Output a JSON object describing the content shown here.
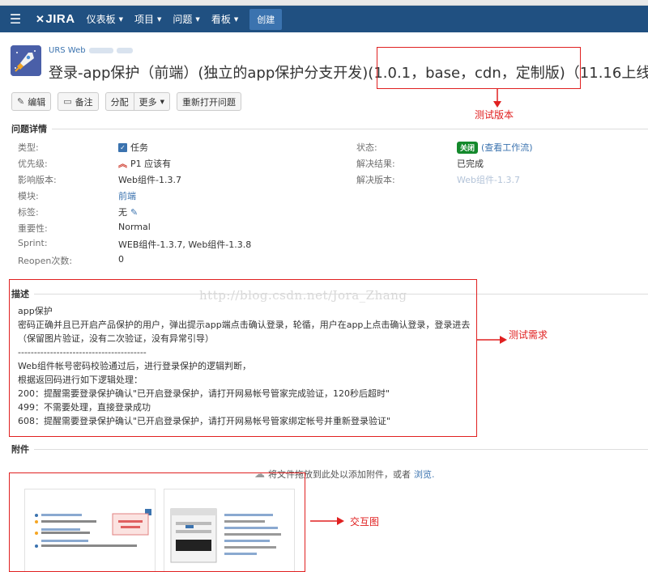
{
  "nav": {
    "logo": "JIRA",
    "items": [
      "仪表板",
      "项目",
      "问题",
      "看板"
    ],
    "create": "创建"
  },
  "header": {
    "project_key": "URS Web",
    "title": "登录-app保护（前端）(独立的app保护分支开发)(1.0.1，base，cdn，定制版)（11.16上线"
  },
  "toolbar": {
    "edit": "编辑",
    "comment": "备注",
    "assign": "分配",
    "more": "更多",
    "reopen": "重新打开问题"
  },
  "details": {
    "heading": "问题详情",
    "left": [
      {
        "label": "类型:",
        "value": "任务"
      },
      {
        "label": "优先级:",
        "value": "P1 应该有"
      },
      {
        "label": "影响版本:",
        "value": "Web组件-1.3.7"
      },
      {
        "label": "模块:",
        "value": "前端"
      },
      {
        "label": "标签:",
        "value": "无"
      },
      {
        "label": "重要性:",
        "value": "Normal"
      },
      {
        "label": "Sprint:",
        "value": "WEB组件-1.3.7, Web组件-1.3.8"
      },
      {
        "label": "Reopen次数:",
        "value": "0"
      }
    ],
    "right": [
      {
        "label": "状态:",
        "badge": "关闭",
        "value": "(查看工作流)"
      },
      {
        "label": "解决结果:",
        "value": "已完成"
      },
      {
        "label": "解决版本:",
        "value": "Web组件-1.3.7"
      }
    ]
  },
  "description": {
    "heading": "描述",
    "lines": [
      "app保护",
      "密码正确并且已开启产品保护的用户，弹出提示app端点击确认登录，轮循，用户在app上点击确认登录，登录进去",
      "（保留图片验证，没有二次验证，没有异常引导）",
      "----------------------------------------",
      "Web组件帐号密码校验通过后，进行登录保护的逻辑判断，",
      "根据返回码进行如下逻辑处理：",
      "200：提醒需要登录保护确认\"已开启登录保护，请打开网易帐号管家完成验证，120秒后超时\"",
      "499：不需要处理，直接登录成功",
      "608：提醒需要登录保护确认\"已开启登录保护，请打开网易帐号管家绑定帐号并重新登录验证\""
    ]
  },
  "attachments": {
    "heading": "附件",
    "drop_text": "将文件拖放到此处以添加附件，或者",
    "browse": "浏览."
  },
  "watermark": "http://blog.csdn.net/Jora_Zhang",
  "annotations": {
    "version": "测试版本",
    "requirements": "测试需求",
    "interaction": "交互图"
  },
  "colors": {
    "nav": "#205081",
    "link": "#3b73af",
    "status_closed": "#14892c",
    "annotation": "#e02020"
  }
}
